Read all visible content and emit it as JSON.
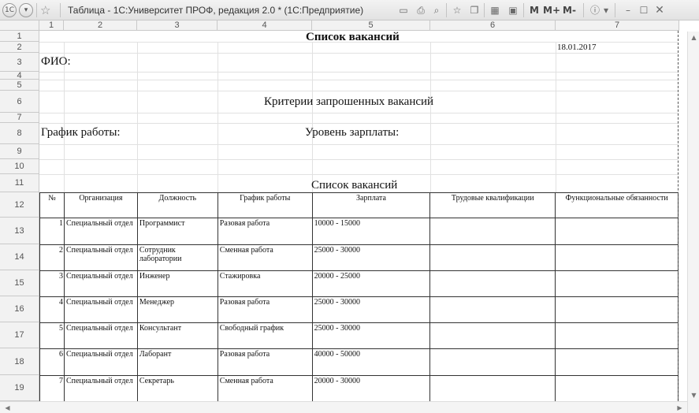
{
  "window": {
    "title": "Таблица - 1С:Университет ПРОФ, редакция 2.0 * (1С:Предприятие)",
    "menu_buttons": [
      "M",
      "M+",
      "M-"
    ]
  },
  "sheet": {
    "column_headers": [
      "1",
      "2",
      "3",
      "4",
      "5",
      "6",
      "7"
    ],
    "row_headers": [
      "1",
      "2",
      "3",
      "4",
      "5",
      "6",
      "7",
      "8",
      "9",
      "10",
      "11",
      "12",
      "13",
      "14",
      "15",
      "16",
      "17",
      "18",
      "19"
    ],
    "doc_title": "Список вакансий",
    "date": "18.01.2017",
    "fio_label": "ФИО:",
    "criteria_title": "Критерии запрошенных вакансий",
    "schedule_label": "График работы:",
    "salary_label": "Уровень зарплаты:",
    "list_title": "Список вакансий"
  },
  "table": {
    "headers": [
      "№",
      "Организация",
      "Должность",
      "График работы",
      "Зарплата",
      "Трудовые квалификации",
      "Функциональные обязанности"
    ],
    "rows": [
      [
        "1",
        "Специальный отдел",
        "Программист",
        "Разовая работа",
        "10000 - 15000",
        "",
        ""
      ],
      [
        "2",
        "Специальный отдел",
        "Сотрудник лаборатории",
        "Сменная работа",
        "25000 - 30000",
        "",
        ""
      ],
      [
        "3",
        "Специальный отдел",
        "Инженер",
        "Стажировка",
        "20000 - 25000",
        "",
        ""
      ],
      [
        "4",
        "Специальный отдел",
        "Менеджер",
        "Разовая работа",
        "25000 - 30000",
        "",
        ""
      ],
      [
        "5",
        "Специальный отдел",
        "Консультант",
        "Свободный график",
        "25000 - 30000",
        "",
        ""
      ],
      [
        "6",
        "Специальный отдел",
        "Лаборант",
        "Разовая работа",
        "40000 - 50000",
        "",
        ""
      ],
      [
        "7",
        "Специальный отдел",
        "Секретарь",
        "Сменная работа",
        "20000 - 30000",
        "",
        ""
      ]
    ]
  },
  "icons": [
    "app-icon",
    "menu-icon",
    "favorite-star-icon",
    "save-icon",
    "print-icon",
    "preview-icon",
    "bookmark-icon",
    "copy-icon",
    "calc-icon",
    "calendar-icon",
    "info-icon",
    "minimize-icon",
    "maximize-icon",
    "close-icon"
  ]
}
